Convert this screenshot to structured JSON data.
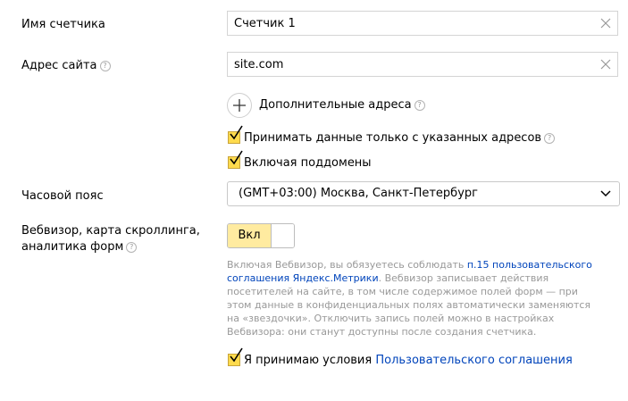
{
  "form": {
    "counter_name": {
      "label": "Имя счетчика",
      "value": "Счетчик 1"
    },
    "site_address": {
      "label": "Адрес сайта",
      "value": "site.com"
    },
    "additional_addresses": {
      "label": "Дополнительные адреса"
    },
    "only_specified": {
      "label": "Принимать данные только с указанных адресов",
      "checked": true
    },
    "include_subdomains": {
      "label": "Включая поддомены",
      "checked": true
    },
    "timezone": {
      "label": "Часовой пояс",
      "value": "(GMT+03:00) Москва, Санкт-Петербург"
    },
    "webvisor": {
      "label_line1": "Вебвизор, карта скроллинга,",
      "label_line2": "аналитика форм",
      "toggle_label": "Вкл",
      "enabled": true,
      "note_prefix": "Включая Вебвизор, вы обязуетесь соблюдать ",
      "note_link": "п.15 пользовательского соглашения Яндекс.Метрики",
      "note_suffix": ". Вебвизор записывает действия посетителей на сайте, в том числе содержимое полей форм — при этом данные в конфиденциальных полях автоматически заменяются на «звездочки». Отключить запись полей можно в настройках Вебвизора: они станут доступны после создания счетчика."
    },
    "agreement": {
      "prefix": "Я принимаю условия ",
      "link": "Пользовательского соглашения",
      "checked": true
    }
  },
  "icons": {
    "help": "?"
  },
  "colors": {
    "accent_checkbox": "#ffdb4d",
    "toggle_on": "#ffeba0",
    "link": "#0044bb",
    "note_text": "#999999"
  }
}
